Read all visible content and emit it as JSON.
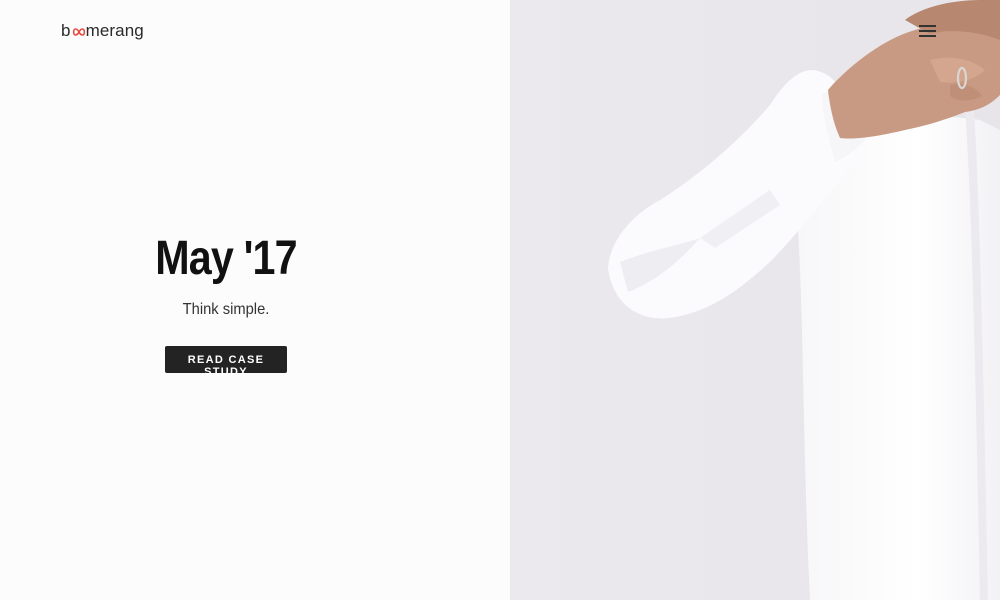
{
  "brand": {
    "logo_text_before": "b",
    "logo_text_after": "merang",
    "logo_icon": "infinity-loop-icon",
    "accent_color": "#e8493f"
  },
  "hero": {
    "title": "May '17",
    "subtitle": "Think simple.",
    "cta_label": "READ CASE STUDY"
  },
  "nav": {
    "menu_icon": "hamburger-menu-icon"
  },
  "photo": {
    "subject": "man-buttoning-white-shirt"
  }
}
